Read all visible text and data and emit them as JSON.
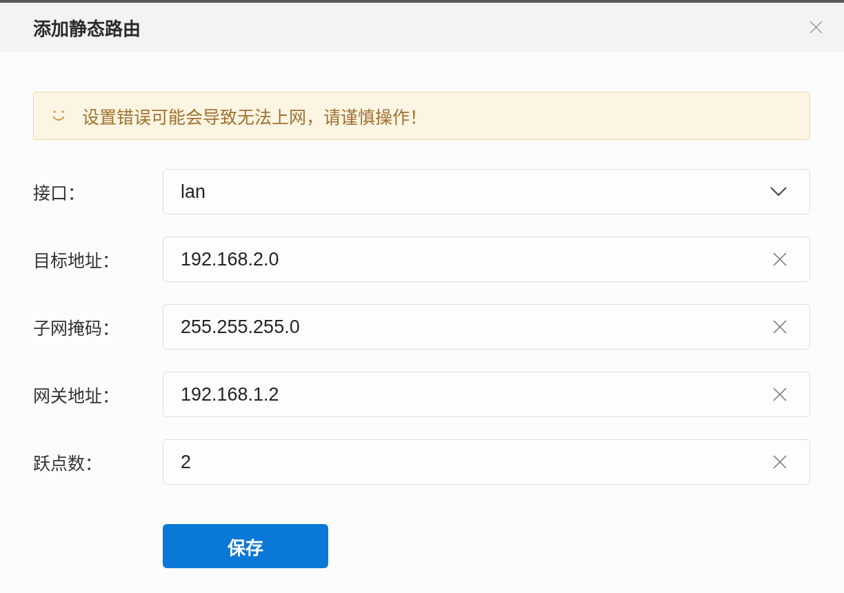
{
  "dialog": {
    "title": "添加静态路由"
  },
  "alert": {
    "text": "设置错误可能会导致无法上网，请谨慎操作！"
  },
  "fields": [
    {
      "kind": "select",
      "label": "接口：",
      "value": "lan"
    },
    {
      "kind": "text",
      "label": "目标地址：",
      "value": "192.168.2.0"
    },
    {
      "kind": "text",
      "label": "子网掩码：",
      "value": "255.255.255.0"
    },
    {
      "kind": "text",
      "label": "网关地址：",
      "value": "192.168.1.2"
    },
    {
      "kind": "text",
      "label": "跃点数：",
      "value": "2"
    }
  ],
  "buttons": [
    {
      "label": "保存"
    }
  ]
}
